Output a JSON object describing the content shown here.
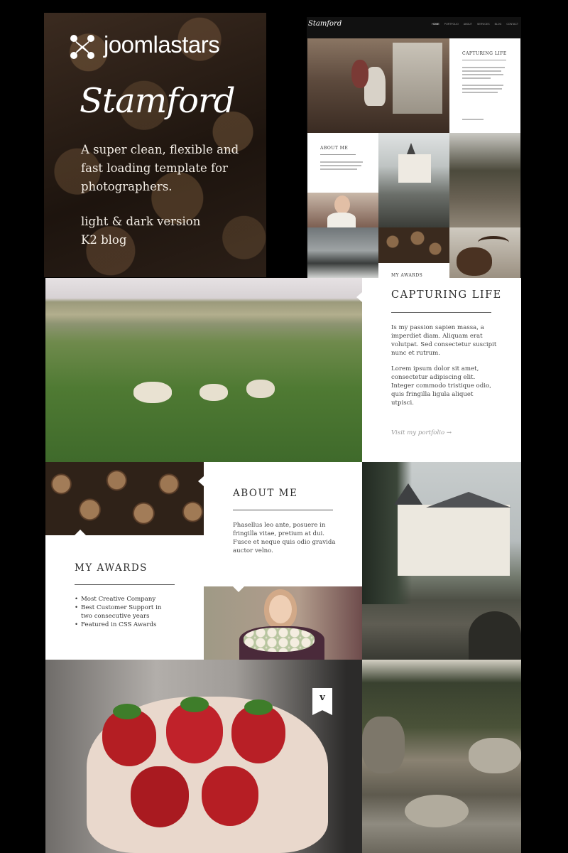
{
  "promo": {
    "brand": "joomlastars",
    "template_name": "Stamford",
    "tagline": "A super clean, flexible and fast loading template for photographers.",
    "feature_1": "light & dark version",
    "feature_2": "K2 blog"
  },
  "preview": {
    "logo": "Stamford",
    "nav": [
      "HOME",
      "PORTFOLIO",
      "ABOUT",
      "SERVICES",
      "BLOG",
      "CONTACT"
    ],
    "capturing_title": "CAPTURING LIFE",
    "about_title": "ABOUT ME",
    "awards_title": "MY AWARDS"
  },
  "capturing": {
    "title": "CAPTURING LIFE",
    "para1": "Is my passion sapien massa, a imperdiet diam. Aliquam erat volutpat. Sed consectetur suscipit nunc et rutrum.",
    "para2": "Lorem ipsum dolor sit amet, consectetur adipiscing elit. Integer commodo tristique odio, quis fringilla ligula aliquet utpisci.",
    "link": "Visit my portfolio →"
  },
  "about": {
    "title": "ABOUT ME",
    "text": "Phasellus leo ante, posuere in fringilla vitae, pretium at dui. Fusce et neque quis odio gravida auctor velno."
  },
  "awards": {
    "title": "MY AWARDS",
    "items": [
      "Most Creative Company",
      "Best Customer Support in two consecutive years",
      "Featured in CSS Awards"
    ]
  },
  "vimeo_icon": "v",
  "colors": {
    "background": "#000000",
    "card": "#ffffff",
    "text": "#2b2b2b"
  }
}
